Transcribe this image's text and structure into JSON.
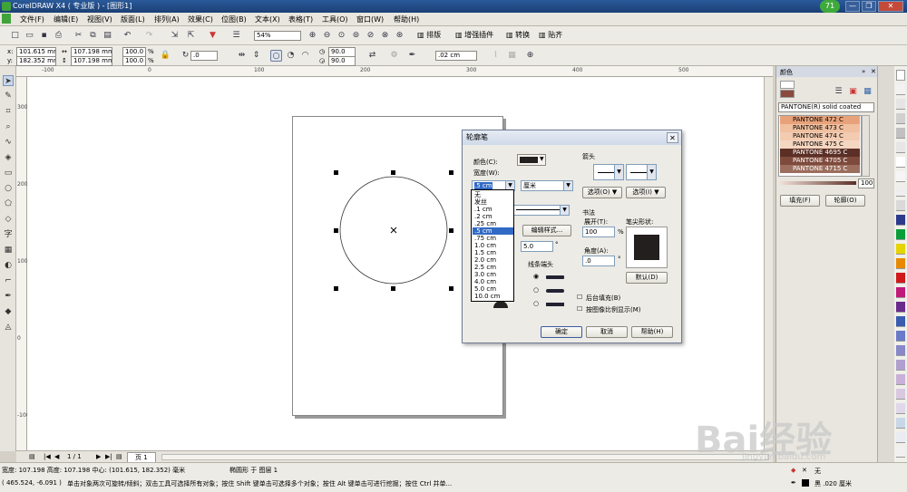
{
  "window": {
    "title": "CorelDRAW X4 ( 专业版 ) - [图形1]",
    "badge": "71",
    "controls": [
      "—",
      "❐",
      "✕"
    ]
  },
  "menu": [
    "文件(F)",
    "编辑(E)",
    "视图(V)",
    "版面(L)",
    "排列(A)",
    "效果(C)",
    "位图(B)",
    "文本(X)",
    "表格(T)",
    "工具(O)",
    "窗口(W)",
    "帮助(H)"
  ],
  "toolbar1": {
    "zoom": "54%",
    "buttons": [
      "排版",
      "增强插件",
      "转换",
      "贴齐"
    ]
  },
  "property_bar": {
    "x_label": "x:",
    "x_value": "101.615 mm",
    "y_label": "y:",
    "y_value": "182.352 mm",
    "w_value": "107.198 mm",
    "h_value": "107.198 mm",
    "sx": "100.0",
    "sy": "100.0",
    "pct": "%",
    "angle": ".0",
    "arc1": "90.0",
    "arc2": "90.0",
    "outline": ".02 cm"
  },
  "rulers": {
    "h_ticks": [
      "-100",
      "0",
      "100",
      "200",
      "300",
      "400",
      "500"
    ],
    "v_ticks": [
      "300",
      "200",
      "100",
      "0",
      "-100"
    ]
  },
  "page_nav": {
    "count": "1 / 1",
    "tab": "页 1"
  },
  "status": {
    "line1": "宽度: 107.198  高度: 107.198  中心: (101.615, 182.352)  毫米",
    "object": "椭圆形 于 图层 1",
    "coords": "( 465.524, -6.091 )",
    "hint": "单击对象两次可旋转/倾斜；双击工具可选择所有对象；按住 Shift 键单击可选择多个对象；按住 Alt 键单击可进行挖掘；按住 Ctrl 并单...",
    "fill_label": "无",
    "outline_label": "黑 .020 厘米"
  },
  "docker": {
    "title": "颜色",
    "library": "PANTONE(R) solid coated",
    "swatches": [
      {
        "name": "PANTONE 472 C",
        "color": "#e8a27a"
      },
      {
        "name": "PANTONE 473 C",
        "color": "#f0c0a0"
      },
      {
        "name": "PANTONE 474 C",
        "color": "#f3cbb0"
      },
      {
        "name": "PANTONE 475 C",
        "color": "#f5d6c0"
      },
      {
        "name": "PANTONE 4695 C",
        "color": "#5b2f26"
      },
      {
        "name": "PANTONE 4705 C",
        "color": "#7e4a3c"
      },
      {
        "name": "PANTONE 4715 C",
        "color": "#9c6e5e"
      }
    ],
    "slider_value": "100",
    "fill_button": "填充(F)",
    "outline_button": "轮廓(O)"
  },
  "dialog": {
    "title": "轮廓笔",
    "color_label": "颜色(C):",
    "width_label": "宽度(W):",
    "width_value": ".5 cm",
    "unit": "厘米",
    "width_options": [
      "无",
      "发丝",
      ".1 cm",
      ".2 cm",
      ".25 cm",
      ".5 cm",
      ".75 cm",
      "1.0 cm",
      "1.5 cm",
      "2.0 cm",
      "2.5 cm",
      "3.0 cm",
      "4.0 cm",
      "5.0 cm",
      "10.0 cm"
    ],
    "edit_style": "编辑样式...",
    "miter_value": "5.0",
    "line_caps_label": "线条端头",
    "arrows_label": "箭头",
    "options1": "选项(O)",
    "options2": "选项(I)",
    "calligraphy_label": "书法",
    "stretch_label": "展开(T):",
    "stretch_value": "100",
    "stretch_pct": "%",
    "nib_label": "笔尖形状:",
    "angle_label": "角度(A):",
    "angle_value": ".0",
    "angle_unit": "°",
    "default_button": "默认(D)",
    "behind_fill": "后台填充(B)",
    "scale_with_image": "按图像比例显示(M)",
    "ok": "确定",
    "cancel": "取消",
    "help": "帮助(H)"
  },
  "watermark": {
    "brand": "Bai经验",
    "url": "jingyan.baidu.com"
  },
  "colors": {
    "titlebar": "#1c3f75",
    "selection": "#316ac5",
    "dialog_bg": "#ecebe5"
  }
}
